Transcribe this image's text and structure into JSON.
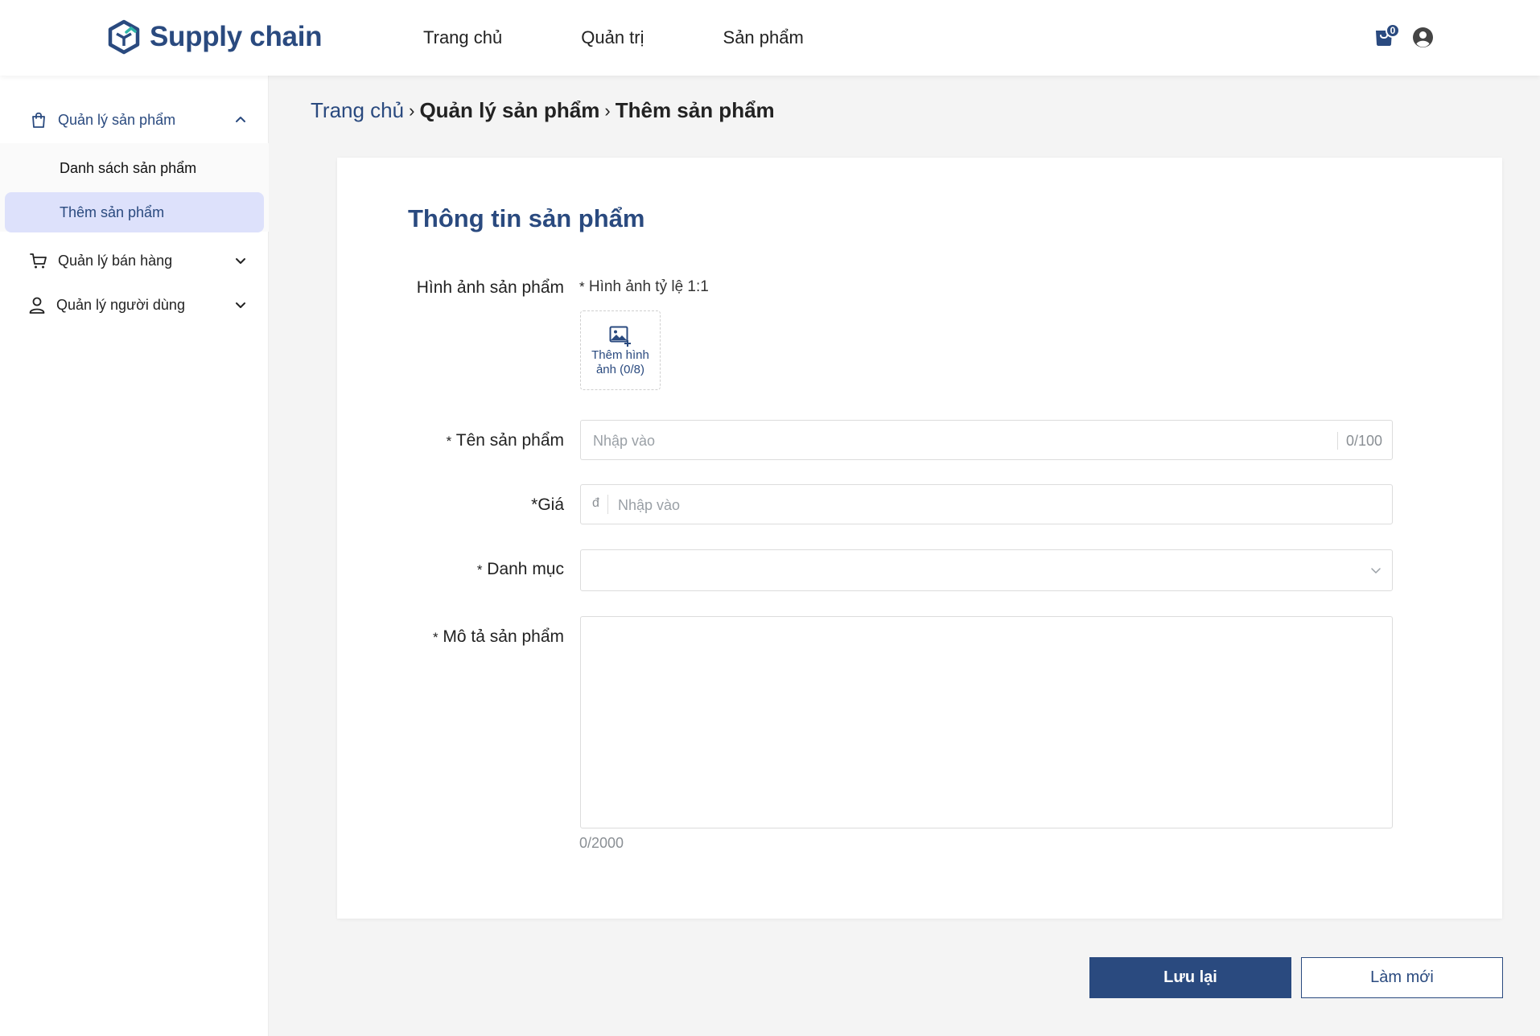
{
  "app": {
    "logo_text": "Supply chain"
  },
  "nav": [
    {
      "label": "Trang chủ"
    },
    {
      "label": "Quản trị"
    },
    {
      "label": "Sản phẩm"
    }
  ],
  "cart": {
    "count": "0"
  },
  "sidebar": {
    "groups": [
      {
        "label": "Quản lý sản phẩm",
        "icon": "shopping-bag-icon",
        "expanded": true,
        "items": [
          {
            "label": "Danh sách sản phẩm"
          },
          {
            "label": "Thêm sản phẩm",
            "selected": true
          }
        ]
      },
      {
        "label": "Quản lý bán hàng",
        "icon": "cart-icon",
        "expanded": false
      },
      {
        "label": "Quản lý người dùng",
        "icon": "user-icon",
        "expanded": false
      }
    ]
  },
  "breadcrumb": {
    "home": "Trang chủ",
    "sep": "›",
    "level1": "Quản lý sản phẩm",
    "level2": "Thêm sản phẩm"
  },
  "form": {
    "title": "Thông tin sản phẩm",
    "image": {
      "label": "Hình ảnh sản phẩm",
      "hint_star": "*",
      "hint": "Hình ảnh tỷ lệ 1:1",
      "upload_line1": "Thêm hình",
      "upload_line2": "ảnh (0/8)"
    },
    "name": {
      "star": "*",
      "label": "Tên sản phẩm",
      "placeholder": "Nhập vào",
      "value": "",
      "counter": "0/100"
    },
    "price": {
      "label": "*Giá",
      "currency": "đ",
      "placeholder": "Nhập vào",
      "value": ""
    },
    "category": {
      "star": "*",
      "label": "Danh mục",
      "value": ""
    },
    "description": {
      "star": "*",
      "label": "Mô tả sản phẩm",
      "value": "",
      "counter": "0/2000"
    }
  },
  "actions": {
    "save": "Lưu lại",
    "reset": "Làm mới"
  },
  "colors": {
    "primary": "#2a4a7f",
    "selected_bg": "#dde1fb",
    "page_bg": "#f4f4f4"
  }
}
